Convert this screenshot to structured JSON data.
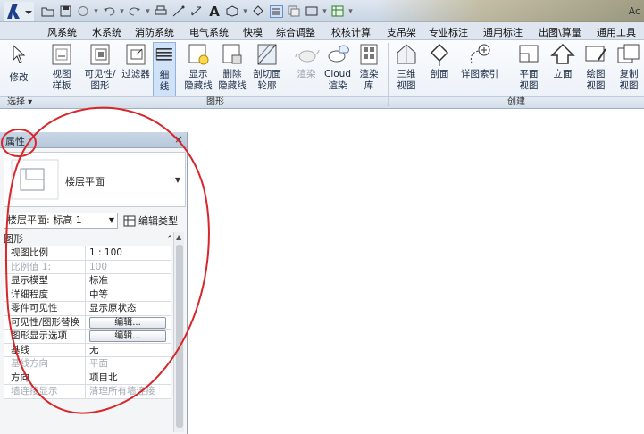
{
  "title_bar": {
    "brand": "Ac"
  },
  "tabs": [
    "风系统",
    "水系统",
    "消防系统",
    "电气系统",
    "快模",
    "综合调整",
    "校核计算",
    "支吊架",
    "专业标注",
    "通用标注",
    "出图\\算量",
    "通用工具"
  ],
  "ribbon": {
    "modify": "修改",
    "view_template": [
      "视图",
      "样板"
    ],
    "visible_graphics": [
      "可见性/",
      "图形"
    ],
    "filters": "过滤器",
    "thin_lines": [
      "细",
      "线"
    ],
    "show_hidden": [
      "显示",
      "隐藏线"
    ],
    "remove_hidden": [
      "删除",
      "隐藏线"
    ],
    "cut_profile": [
      "剖切面",
      "轮廓"
    ],
    "render": "渲染",
    "cloud_render": [
      "Cloud",
      "渲染"
    ],
    "render_gallery": [
      "渲染",
      "库"
    ],
    "view_3d": [
      "三维",
      "视图"
    ],
    "section": "剖面",
    "callout": "详图索引",
    "plan_views": [
      "平面",
      "视图"
    ],
    "elevation": "立面",
    "drafting_view": [
      "绘图",
      "视图"
    ],
    "duplicate_view": [
      "复制",
      "视图"
    ],
    "groups": {
      "select": "选择 ▾",
      "graphics": "图形",
      "create": "创建"
    }
  },
  "properties": {
    "title": "属性",
    "type_name": "楼层平面",
    "instance": "楼层平面: 标高 1",
    "edit_type": "编辑类型",
    "category": "图形",
    "rows": [
      {
        "label": "视图比例",
        "value": "1 : 100",
        "dim": false
      },
      {
        "label": "比例值 1:",
        "value": "100",
        "dim": true
      },
      {
        "label": "显示模型",
        "value": "标准",
        "dim": false
      },
      {
        "label": "详细程度",
        "value": "中等",
        "dim": false
      },
      {
        "label": "零件可见性",
        "value": "显示原状态",
        "dim": false
      },
      {
        "label": "可见性/图形替换",
        "value": "编辑...",
        "dim": false,
        "button": true
      },
      {
        "label": "图形显示选项",
        "value": "编辑...",
        "dim": false,
        "button": true
      },
      {
        "label": "基线",
        "value": "无",
        "dim": false
      },
      {
        "label": "基线方向",
        "value": "平面",
        "dim": true
      },
      {
        "label": "方向",
        "value": "项目北",
        "dim": false
      },
      {
        "label": "墙连接显示",
        "value": "清理所有墙连接",
        "dim": true
      }
    ]
  },
  "colors": {
    "annotation": "#d9262b",
    "ribbon_active": "#cfe2f7"
  },
  "icons": [
    "app-logo-icon",
    "open-icon",
    "save-icon",
    "sync-icon",
    "undo-icon",
    "redo-icon",
    "measure-icon",
    "text-icon",
    "close-icon"
  ]
}
